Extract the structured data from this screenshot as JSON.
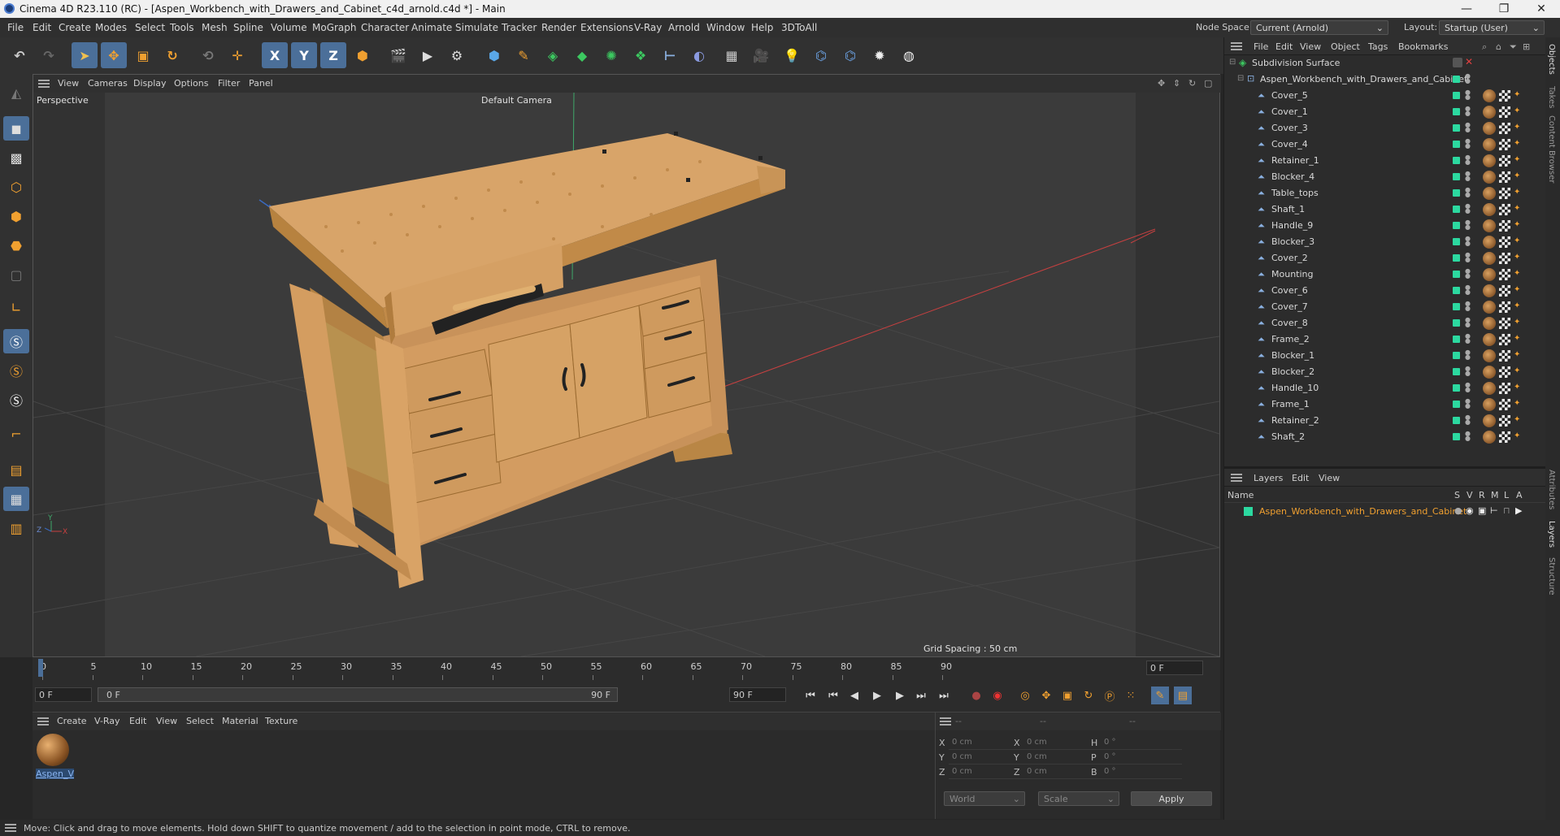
{
  "titlebar": {
    "title": "Cinema 4D R23.110 (RC) - [Aspen_Workbench_with_Drawers_and_Cabinet_c4d_arnold.c4d *] - Main",
    "min": "—",
    "max": "❐",
    "close": "✕"
  },
  "menu": [
    "File",
    "Edit",
    "Create",
    "Modes",
    "Select",
    "Tools",
    "Mesh",
    "Spline",
    "Volume",
    "MoGraph",
    "Character",
    "Animate",
    "Simulate",
    "Tracker",
    "Render",
    "Extensions",
    "V-Ray",
    "Arnold",
    "Window",
    "Help",
    "3DToAll"
  ],
  "nodespace": {
    "label": "Node Space:",
    "value": "Current (Arnold)",
    "layout_label": "Layout:",
    "layout_value": "Startup (User)"
  },
  "toolbar": {
    "axis_x": "X",
    "axis_y": "Y",
    "axis_z": "Z"
  },
  "viewport": {
    "menu": [
      "View",
      "Cameras",
      "Display",
      "Options",
      "Filter",
      "Panel"
    ],
    "name": "Perspective",
    "camera": "Default Camera",
    "grid": "Grid Spacing : 50 cm"
  },
  "timeline": {
    "ticks": [
      "0",
      "5",
      "10",
      "15",
      "20",
      "25",
      "30",
      "35",
      "40",
      "45",
      "50",
      "55",
      "60",
      "65",
      "70",
      "75",
      "80",
      "85",
      "90"
    ],
    "current": "0 F"
  },
  "transport": {
    "start": "0 F",
    "slider_start": "0 F",
    "slider_end": "90 F",
    "end": "90 F"
  },
  "materials": {
    "menu": [
      "Create",
      "V-Ray",
      "Edit",
      "View",
      "Select",
      "Material",
      "Texture"
    ],
    "items": [
      {
        "name": "Aspen_V"
      }
    ]
  },
  "coords": {
    "head": [
      "--",
      "--",
      "--"
    ],
    "rows": [
      {
        "l1": "X",
        "v1": "0 cm",
        "l2": "X",
        "v2": "0 cm",
        "l3": "H",
        "v3": "0 °"
      },
      {
        "l1": "Y",
        "v1": "0 cm",
        "l2": "Y",
        "v2": "0 cm",
        "l3": "P",
        "v3": "0 °"
      },
      {
        "l1": "Z",
        "v1": "0 cm",
        "l2": "Z",
        "v2": "0 cm",
        "l3": "B",
        "v3": "0 °"
      }
    ],
    "world": "World",
    "scale": "Scale",
    "apply": "Apply"
  },
  "objects": {
    "menu": [
      "File",
      "Edit",
      "View",
      "Object",
      "Tags",
      "Bookmarks"
    ],
    "root": "Subdivision Surface",
    "group": "Aspen_Workbench_with_Drawers_and_Cabinet",
    "items": [
      "Cover_5",
      "Cover_1",
      "Cover_3",
      "Cover_4",
      "Retainer_1",
      "Blocker_4",
      "Table_tops",
      "Shaft_1",
      "Handle_9",
      "Blocker_3",
      "Cover_2",
      "Mounting",
      "Cover_6",
      "Cover_7",
      "Cover_8",
      "Frame_2",
      "Blocker_1",
      "Blocker_2",
      "Handle_10",
      "Frame_1",
      "Retainer_2",
      "Shaft_2"
    ]
  },
  "layers": {
    "menu": [
      "Layers",
      "Edit",
      "View"
    ],
    "col_name": "Name",
    "cols": [
      "S",
      "V",
      "R",
      "M",
      "L",
      "A"
    ],
    "item": "Aspen_Workbench_with_Drawers_and_Cabinet"
  },
  "sidetabs": [
    "Objects",
    "Takes",
    "Content Browser",
    "Attributes",
    "Layers",
    "Structure"
  ],
  "status": "Move: Click and drag to move elements. Hold down SHIFT to quantize movement / add to the selection in point mode, CTRL to remove.",
  "colors": {
    "accent": "#4b6f99",
    "visible": "#2cd9a0",
    "layer": "#f0a030"
  }
}
